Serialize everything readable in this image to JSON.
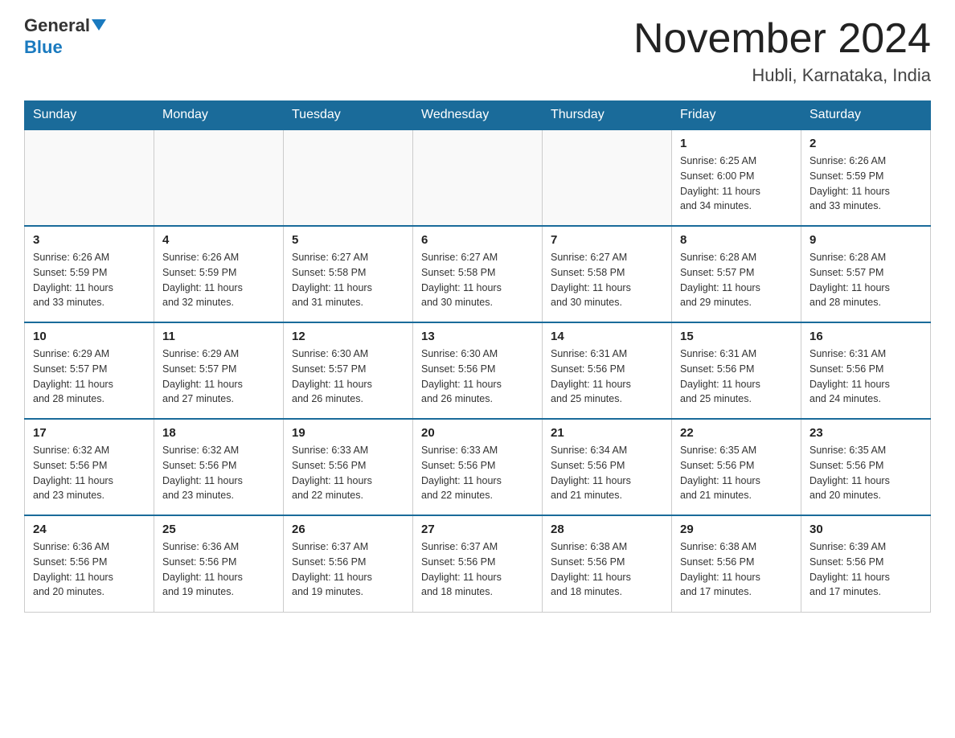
{
  "header": {
    "logo_general": "General",
    "logo_blue": "Blue",
    "month_title": "November 2024",
    "location": "Hubli, Karnataka, India"
  },
  "days_of_week": [
    "Sunday",
    "Monday",
    "Tuesday",
    "Wednesday",
    "Thursday",
    "Friday",
    "Saturday"
  ],
  "weeks": [
    [
      {
        "day": "",
        "info": ""
      },
      {
        "day": "",
        "info": ""
      },
      {
        "day": "",
        "info": ""
      },
      {
        "day": "",
        "info": ""
      },
      {
        "day": "",
        "info": ""
      },
      {
        "day": "1",
        "info": "Sunrise: 6:25 AM\nSunset: 6:00 PM\nDaylight: 11 hours\nand 34 minutes."
      },
      {
        "day": "2",
        "info": "Sunrise: 6:26 AM\nSunset: 5:59 PM\nDaylight: 11 hours\nand 33 minutes."
      }
    ],
    [
      {
        "day": "3",
        "info": "Sunrise: 6:26 AM\nSunset: 5:59 PM\nDaylight: 11 hours\nand 33 minutes."
      },
      {
        "day": "4",
        "info": "Sunrise: 6:26 AM\nSunset: 5:59 PM\nDaylight: 11 hours\nand 32 minutes."
      },
      {
        "day": "5",
        "info": "Sunrise: 6:27 AM\nSunset: 5:58 PM\nDaylight: 11 hours\nand 31 minutes."
      },
      {
        "day": "6",
        "info": "Sunrise: 6:27 AM\nSunset: 5:58 PM\nDaylight: 11 hours\nand 30 minutes."
      },
      {
        "day": "7",
        "info": "Sunrise: 6:27 AM\nSunset: 5:58 PM\nDaylight: 11 hours\nand 30 minutes."
      },
      {
        "day": "8",
        "info": "Sunrise: 6:28 AM\nSunset: 5:57 PM\nDaylight: 11 hours\nand 29 minutes."
      },
      {
        "day": "9",
        "info": "Sunrise: 6:28 AM\nSunset: 5:57 PM\nDaylight: 11 hours\nand 28 minutes."
      }
    ],
    [
      {
        "day": "10",
        "info": "Sunrise: 6:29 AM\nSunset: 5:57 PM\nDaylight: 11 hours\nand 28 minutes."
      },
      {
        "day": "11",
        "info": "Sunrise: 6:29 AM\nSunset: 5:57 PM\nDaylight: 11 hours\nand 27 minutes."
      },
      {
        "day": "12",
        "info": "Sunrise: 6:30 AM\nSunset: 5:57 PM\nDaylight: 11 hours\nand 26 minutes."
      },
      {
        "day": "13",
        "info": "Sunrise: 6:30 AM\nSunset: 5:56 PM\nDaylight: 11 hours\nand 26 minutes."
      },
      {
        "day": "14",
        "info": "Sunrise: 6:31 AM\nSunset: 5:56 PM\nDaylight: 11 hours\nand 25 minutes."
      },
      {
        "day": "15",
        "info": "Sunrise: 6:31 AM\nSunset: 5:56 PM\nDaylight: 11 hours\nand 25 minutes."
      },
      {
        "day": "16",
        "info": "Sunrise: 6:31 AM\nSunset: 5:56 PM\nDaylight: 11 hours\nand 24 minutes."
      }
    ],
    [
      {
        "day": "17",
        "info": "Sunrise: 6:32 AM\nSunset: 5:56 PM\nDaylight: 11 hours\nand 23 minutes."
      },
      {
        "day": "18",
        "info": "Sunrise: 6:32 AM\nSunset: 5:56 PM\nDaylight: 11 hours\nand 23 minutes."
      },
      {
        "day": "19",
        "info": "Sunrise: 6:33 AM\nSunset: 5:56 PM\nDaylight: 11 hours\nand 22 minutes."
      },
      {
        "day": "20",
        "info": "Sunrise: 6:33 AM\nSunset: 5:56 PM\nDaylight: 11 hours\nand 22 minutes."
      },
      {
        "day": "21",
        "info": "Sunrise: 6:34 AM\nSunset: 5:56 PM\nDaylight: 11 hours\nand 21 minutes."
      },
      {
        "day": "22",
        "info": "Sunrise: 6:35 AM\nSunset: 5:56 PM\nDaylight: 11 hours\nand 21 minutes."
      },
      {
        "day": "23",
        "info": "Sunrise: 6:35 AM\nSunset: 5:56 PM\nDaylight: 11 hours\nand 20 minutes."
      }
    ],
    [
      {
        "day": "24",
        "info": "Sunrise: 6:36 AM\nSunset: 5:56 PM\nDaylight: 11 hours\nand 20 minutes."
      },
      {
        "day": "25",
        "info": "Sunrise: 6:36 AM\nSunset: 5:56 PM\nDaylight: 11 hours\nand 19 minutes."
      },
      {
        "day": "26",
        "info": "Sunrise: 6:37 AM\nSunset: 5:56 PM\nDaylight: 11 hours\nand 19 minutes."
      },
      {
        "day": "27",
        "info": "Sunrise: 6:37 AM\nSunset: 5:56 PM\nDaylight: 11 hours\nand 18 minutes."
      },
      {
        "day": "28",
        "info": "Sunrise: 6:38 AM\nSunset: 5:56 PM\nDaylight: 11 hours\nand 18 minutes."
      },
      {
        "day": "29",
        "info": "Sunrise: 6:38 AM\nSunset: 5:56 PM\nDaylight: 11 hours\nand 17 minutes."
      },
      {
        "day": "30",
        "info": "Sunrise: 6:39 AM\nSunset: 5:56 PM\nDaylight: 11 hours\nand 17 minutes."
      }
    ]
  ]
}
